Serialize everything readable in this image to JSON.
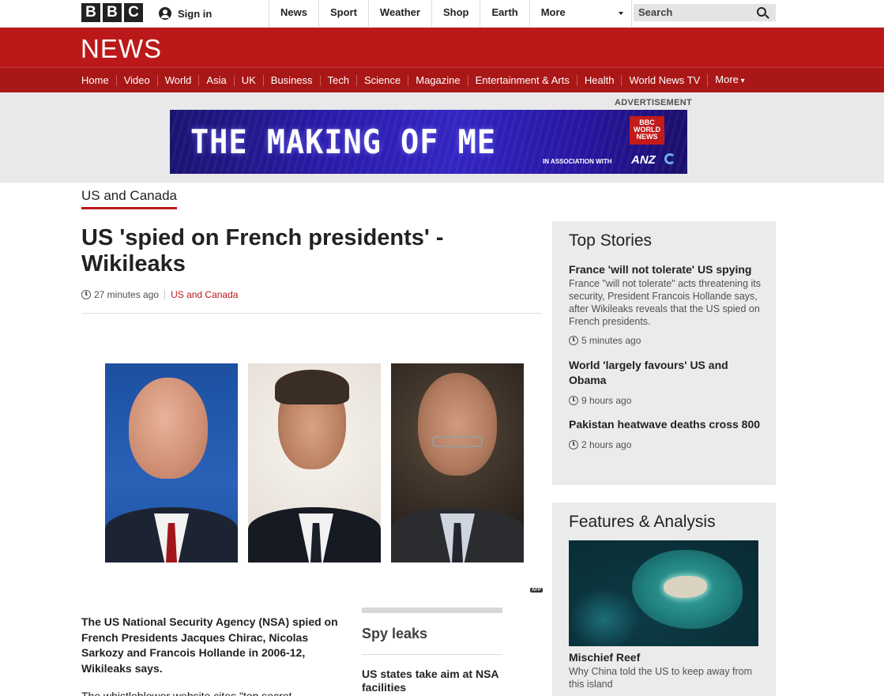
{
  "masthead": {
    "logo_letters": [
      "B",
      "B",
      "C"
    ],
    "signin_label": "Sign in",
    "nav": [
      "News",
      "Sport",
      "Weather",
      "Shop",
      "Earth",
      "More"
    ],
    "search_placeholder": "Search"
  },
  "news_banner": {
    "wordmark": "NEWS",
    "nav": [
      "Home",
      "Video",
      "World",
      "Asia",
      "UK",
      "Business",
      "Tech",
      "Science",
      "Magazine",
      "Entertainment & Arts",
      "Health",
      "World News TV",
      "More"
    ]
  },
  "advert": {
    "label": "ADVERTISEMENT",
    "title": "THE MAKING OF ME",
    "badge": "BBC WORLD NEWS",
    "association": "IN ASSOCIATION WITH",
    "sponsor": "ANZ"
  },
  "section_tag": "US and Canada",
  "article": {
    "headline": "US 'spied on French presidents' - Wikileaks",
    "time": "27 minutes ago",
    "section": "US and Canada",
    "summary": "The US National Security Agency (NSA) spied on French Presidents Jacques Chirac, Nicolas Sarkozy and Francois Hollande in 2006-12, Wikileaks says.",
    "body_start": "The whistleblower website cites \"top secret",
    "photo_credit": "AFP"
  },
  "related": {
    "title": "Spy leaks",
    "links": [
      "US states take aim at NSA facilities"
    ]
  },
  "top_stories": {
    "title": "Top Stories",
    "items": [
      {
        "headline": "France 'will not tolerate' US spying",
        "summary": "France \"will not tolerate\" acts threatening its security, President Francois Hollande says, after Wikileaks reveals that the US spied on French presidents.",
        "time": "5 minutes ago"
      },
      {
        "headline": "World 'largely favours' US and Obama",
        "time": "9 hours ago"
      },
      {
        "headline": "Pakistan heatwave deaths cross 800",
        "time": "2 hours ago"
      }
    ]
  },
  "features": {
    "title": "Features & Analysis",
    "items": [
      {
        "headline": "Mischief Reef",
        "summary": "Why China told the US to keep away from this island"
      }
    ]
  },
  "colors": {
    "brand_red": "#bb1919",
    "nav_red": "#a91717",
    "panel_grey": "#ebebeb"
  }
}
